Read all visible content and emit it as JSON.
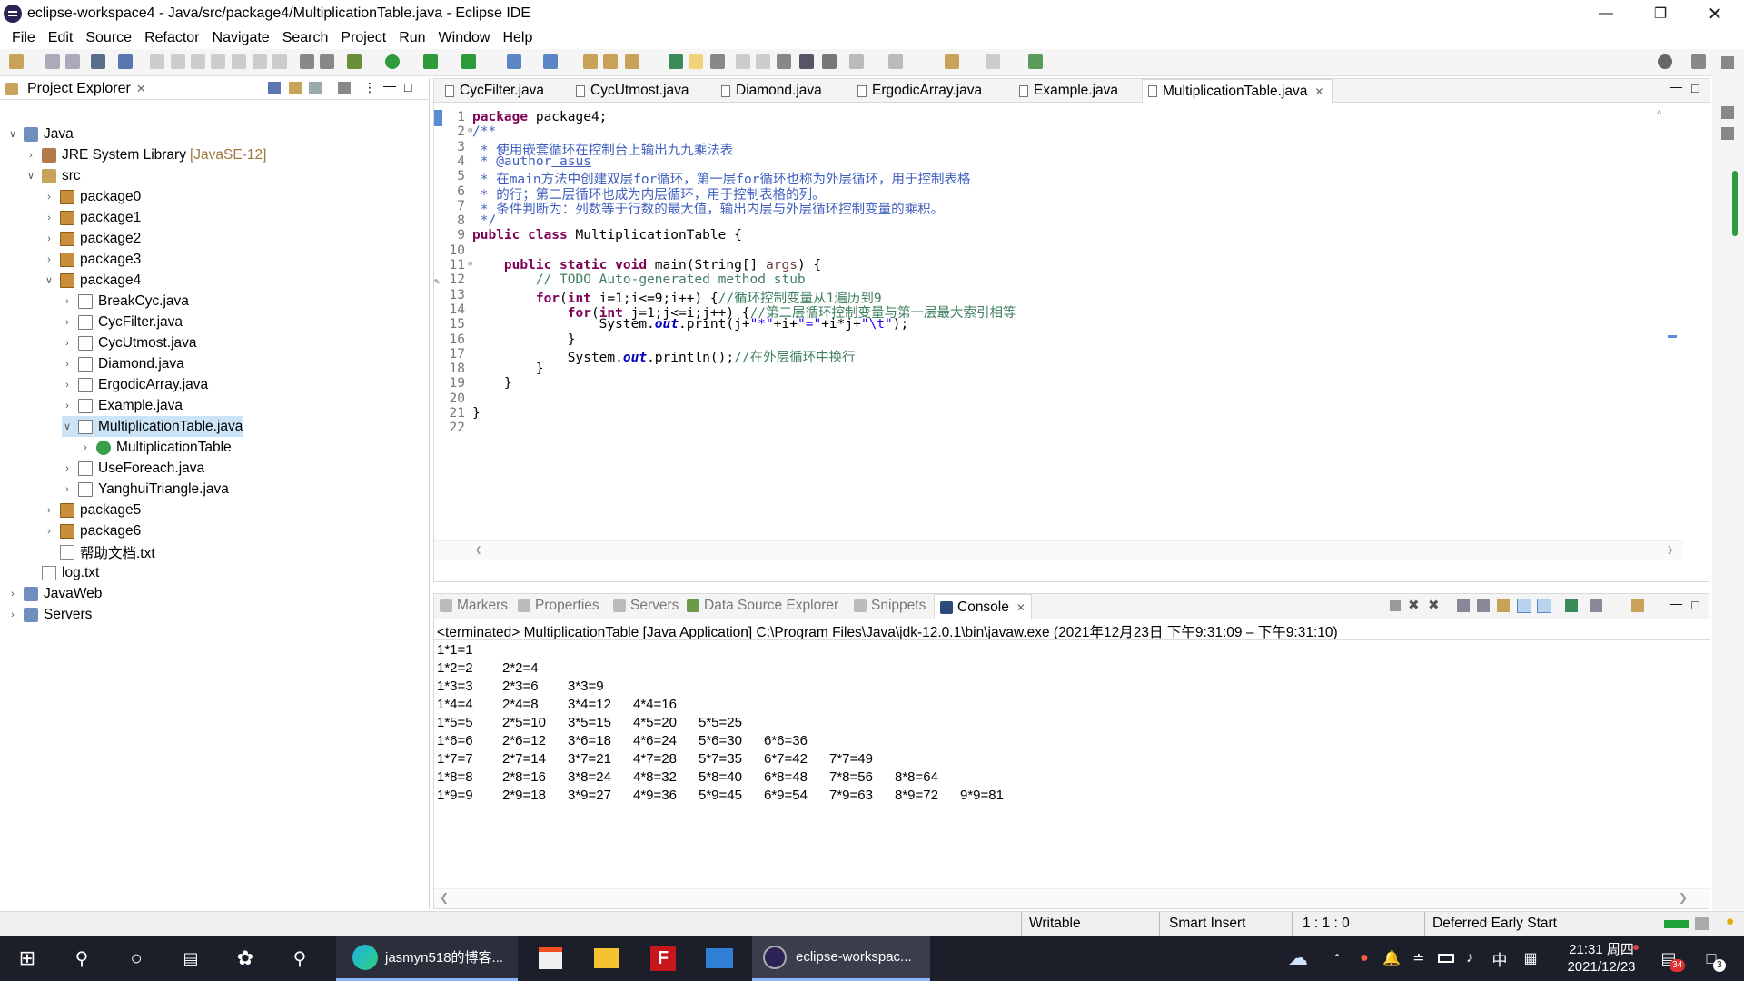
{
  "window": {
    "title": "eclipse-workspace4 - Java/src/package4/MultiplicationTable.java - Eclipse IDE"
  },
  "menu": [
    "File",
    "Edit",
    "Source",
    "Refactor",
    "Navigate",
    "Search",
    "Project",
    "Run",
    "Window",
    "Help"
  ],
  "project_explorer": {
    "title": "Project Explorer",
    "tree": [
      {
        "label": "Java",
        "icon": "project-icon",
        "toggle": "v"
      },
      {
        "label": "JRE System Library",
        "extra": "[JavaSE-12]",
        "icon": "library-icon",
        "toggle": ">"
      },
      {
        "label": "src",
        "icon": "source-folder-icon",
        "toggle": "v"
      },
      {
        "label": "package0",
        "icon": "package-icon",
        "toggle": ">"
      },
      {
        "label": "package1",
        "icon": "package-icon",
        "toggle": ">"
      },
      {
        "label": "package2",
        "icon": "package-icon",
        "toggle": ">"
      },
      {
        "label": "package3",
        "icon": "package-icon",
        "toggle": ">"
      },
      {
        "label": "package4",
        "icon": "package-icon",
        "toggle": "v"
      },
      {
        "label": "BreakCyc.java",
        "icon": "java-file-icon",
        "toggle": ">"
      },
      {
        "label": "CycFilter.java",
        "icon": "java-file-icon",
        "toggle": ">"
      },
      {
        "label": "CycUtmost.java",
        "icon": "java-file-icon",
        "toggle": ">"
      },
      {
        "label": "Diamond.java",
        "icon": "java-file-icon",
        "toggle": ">"
      },
      {
        "label": "ErgodicArray.java",
        "icon": "java-file-icon",
        "toggle": ">"
      },
      {
        "label": "Example.java",
        "icon": "java-file-icon",
        "toggle": ">"
      },
      {
        "label": "MultiplicationTable.java",
        "icon": "java-file-icon",
        "toggle": "v",
        "selected": true
      },
      {
        "label": "MultiplicationTable",
        "icon": "class-icon",
        "toggle": ">"
      },
      {
        "label": "UseForeach.java",
        "icon": "java-file-icon",
        "toggle": ">"
      },
      {
        "label": "YanghuiTriangle.java",
        "icon": "java-file-icon",
        "toggle": ">"
      },
      {
        "label": "package5",
        "icon": "package-icon",
        "toggle": ">"
      },
      {
        "label": "package6",
        "icon": "package-icon",
        "toggle": ">"
      },
      {
        "label": "帮助文档.txt",
        "icon": "text-file-icon",
        "toggle": ""
      },
      {
        "label": "log.txt",
        "icon": "text-file-icon",
        "toggle": ""
      },
      {
        "label": "JavaWeb",
        "icon": "project-icon",
        "toggle": ">"
      },
      {
        "label": "Servers",
        "icon": "folder-icon",
        "toggle": ">"
      }
    ]
  },
  "editor_tabs": [
    "CycFilter.java",
    "CycUtmost.java",
    "Diamond.java",
    "ErgodicArray.java",
    "Example.java",
    "MultiplicationTable.java"
  ],
  "code_lines": [
    "1",
    "2",
    "3",
    "4",
    "5",
    "6",
    "7",
    "8",
    "9",
    "10",
    "11",
    "12",
    "13",
    "14",
    "15",
    "16",
    "17",
    "18",
    "19",
    "20",
    "21",
    "22"
  ],
  "code": {
    "l1a": "package",
    "l1b": " package4;",
    "l2": "/**",
    "l3": " * 使用嵌套循环在控制台上输出九九乘法表",
    "l4a": " * ",
    "l4b": "@author",
    "l4c": " asus",
    "l5": " * 在main方法中创建双层for循环，第一层for循环也称为外层循环，用于控制表格",
    "l6": " * 的行；第二层循环也成为内层循环，用于控制表格的列。",
    "l7": " * 条件判断为：列数等于行数的最大值，输出内层与外层循环控制变量的乘积。",
    "l8": " */",
    "l9a": "public class",
    "l9b": " MultiplicationTable {",
    "l11a": "    public static void",
    "l11b": " main(String[] ",
    "l11c": "args",
    "l11d": ") {",
    "l12": "        // TODO Auto-generated method stub",
    "l13a": "        for",
    "l13b": "(",
    "l13c": "int",
    "l13d": " i=1;i<=9;i++) {",
    "l13e": "//循环控制变量从1遍历到9",
    "l14a": "            for",
    "l14b": "(",
    "l14c": "int",
    "l14d": " j=1;j<=i;j++) {",
    "l14e": "//第二层循环控制变量与第一层最大索引相等",
    "l15a": "                System.",
    "l15b": "out",
    "l15c": ".print(j+",
    "l15d": "\"*\"",
    "l15e": "+i+",
    "l15f": "\"=\"",
    "l15g": "+i*j+",
    "l15h": "\"\\t\"",
    "l15i": ");",
    "l16": "            }",
    "l17a": "            System.",
    "l17b": "out",
    "l17c": ".println();",
    "l17d": "//在外层循环中换行",
    "l18": "        }",
    "l19": "    }",
    "l21": "}"
  },
  "console_tabs": [
    "Markers",
    "Properties",
    "Servers",
    "Data Source Explorer",
    "Snippets",
    "Console"
  ],
  "console": {
    "terminated": "<terminated> MultiplicationTable [Java Application] C:\\Program Files\\Java\\jdk-12.0.1\\bin\\javaw.exe  (2021年12月23日 下午9:31:09 – 下午9:31:10)",
    "rows": [
      [
        "1*1=1"
      ],
      [
        "1*2=2",
        "2*2=4"
      ],
      [
        "1*3=3",
        "2*3=6",
        "3*3=9"
      ],
      [
        "1*4=4",
        "2*4=8",
        "3*4=12",
        "4*4=16"
      ],
      [
        "1*5=5",
        "2*5=10",
        "3*5=15",
        "4*5=20",
        "5*5=25"
      ],
      [
        "1*6=6",
        "2*6=12",
        "3*6=18",
        "4*6=24",
        "5*6=30",
        "6*6=36"
      ],
      [
        "1*7=7",
        "2*7=14",
        "3*7=21",
        "4*7=28",
        "5*7=35",
        "6*7=42",
        "7*7=49"
      ],
      [
        "1*8=8",
        "2*8=16",
        "3*8=24",
        "4*8=32",
        "5*8=40",
        "6*8=48",
        "7*8=56",
        "8*8=64"
      ],
      [
        "1*9=9",
        "2*9=18",
        "3*9=27",
        "4*9=36",
        "5*9=45",
        "6*9=54",
        "7*9=63",
        "8*9=72",
        "9*9=81"
      ]
    ]
  },
  "status": {
    "writable": "Writable",
    "insert": "Smart Insert",
    "position": "1 : 1 : 0",
    "deferred": "Deferred Early Start"
  },
  "taskbar": {
    "edge_label": "jasmyn518的博客...",
    "eclipse_label": "eclipse-workspac...",
    "ime": "中",
    "time": "21:31 周四",
    "date": "2021/12/23",
    "notif_badge": "34",
    "action_badge": "3"
  },
  "colors": {
    "keyword": "#7f0055",
    "javadoc": "#3f5fbf",
    "comment": "#3f7f5f",
    "string": "#2a00ff",
    "field": "#0000c0",
    "taskbar": "#1c1f2a",
    "selection": "#cce4f7"
  }
}
